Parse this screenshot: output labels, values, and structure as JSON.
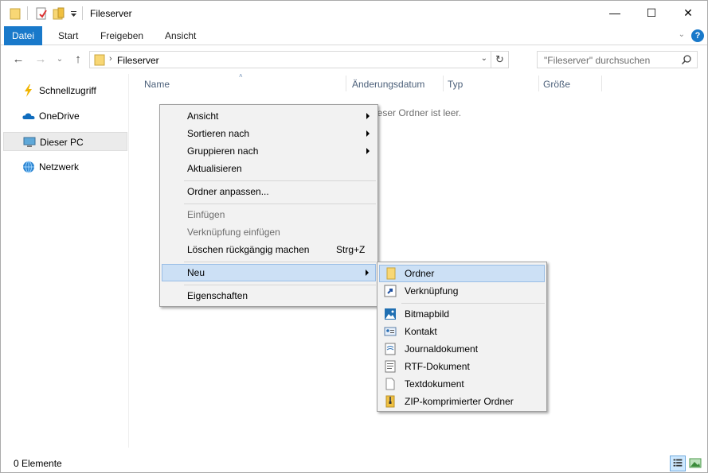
{
  "window": {
    "title": "Fileserver",
    "minimize_glyph": "—",
    "maximize_glyph": "☐",
    "close_glyph": "✕"
  },
  "ribbon": {
    "tabs": [
      "Datei",
      "Start",
      "Freigeben",
      "Ansicht"
    ],
    "active_tab": "Datei",
    "help_glyph": "?",
    "collapse_glyph": "⌄"
  },
  "nav": {
    "back_glyph": "←",
    "forward_glyph": "→",
    "recent_glyph": "⌄",
    "up_glyph": "↑"
  },
  "address": {
    "separator": "›",
    "path": "Fileserver",
    "dropdown_glyph": "⌄",
    "refresh_glyph": "↻"
  },
  "search": {
    "placeholder": "\"Fileserver\" durchsuchen"
  },
  "sidebar": {
    "items": [
      {
        "label": "Schnellzugriff",
        "icon": "star-icon"
      },
      {
        "label": "OneDrive",
        "icon": "cloud-icon"
      },
      {
        "label": "Dieser PC",
        "icon": "computer-icon",
        "selected": true
      },
      {
        "label": "Netzwerk",
        "icon": "network-icon"
      }
    ]
  },
  "columns": {
    "name": "Name",
    "date": "Änderungsdatum",
    "type": "Typ",
    "size": "Größe",
    "sort_glyph": "˄"
  },
  "content": {
    "empty_message": "ieser Ordner ist leer."
  },
  "status": {
    "items_count": "0 Elemente"
  },
  "context_menu": {
    "items": [
      {
        "label": "Ansicht",
        "submenu": true
      },
      {
        "label": "Sortieren nach",
        "submenu": true
      },
      {
        "label": "Gruppieren nach",
        "submenu": true
      },
      {
        "label": "Aktualisieren"
      },
      {
        "label": "Ordner anpassen..."
      },
      {
        "label": "Einfügen",
        "disabled": true
      },
      {
        "label": "Verknüpfung einfügen",
        "disabled": true
      },
      {
        "label": "Löschen rückgängig machen",
        "accelerator": "Strg+Z"
      },
      {
        "label": "Neu",
        "submenu": true,
        "highlighted": true
      },
      {
        "label": "Eigenschaften"
      }
    ]
  },
  "new_submenu": {
    "items": [
      {
        "label": "Ordner",
        "icon": "folder-icon",
        "highlighted": true
      },
      {
        "label": "Verknüpfung",
        "icon": "shortcut-icon"
      },
      {
        "label": "Bitmapbild",
        "icon": "bitmap-icon"
      },
      {
        "label": "Kontakt",
        "icon": "contact-icon"
      },
      {
        "label": "Journaldokument",
        "icon": "journal-icon"
      },
      {
        "label": "RTF-Dokument",
        "icon": "rtf-icon"
      },
      {
        "label": "Textdokument",
        "icon": "text-document-icon"
      },
      {
        "label": "ZIP-komprimierter Ordner",
        "icon": "zip-folder-icon"
      }
    ]
  },
  "colors": {
    "accent": "#1979ca",
    "folder": "#f8d775",
    "menu_highlight": "#cce0f5"
  }
}
